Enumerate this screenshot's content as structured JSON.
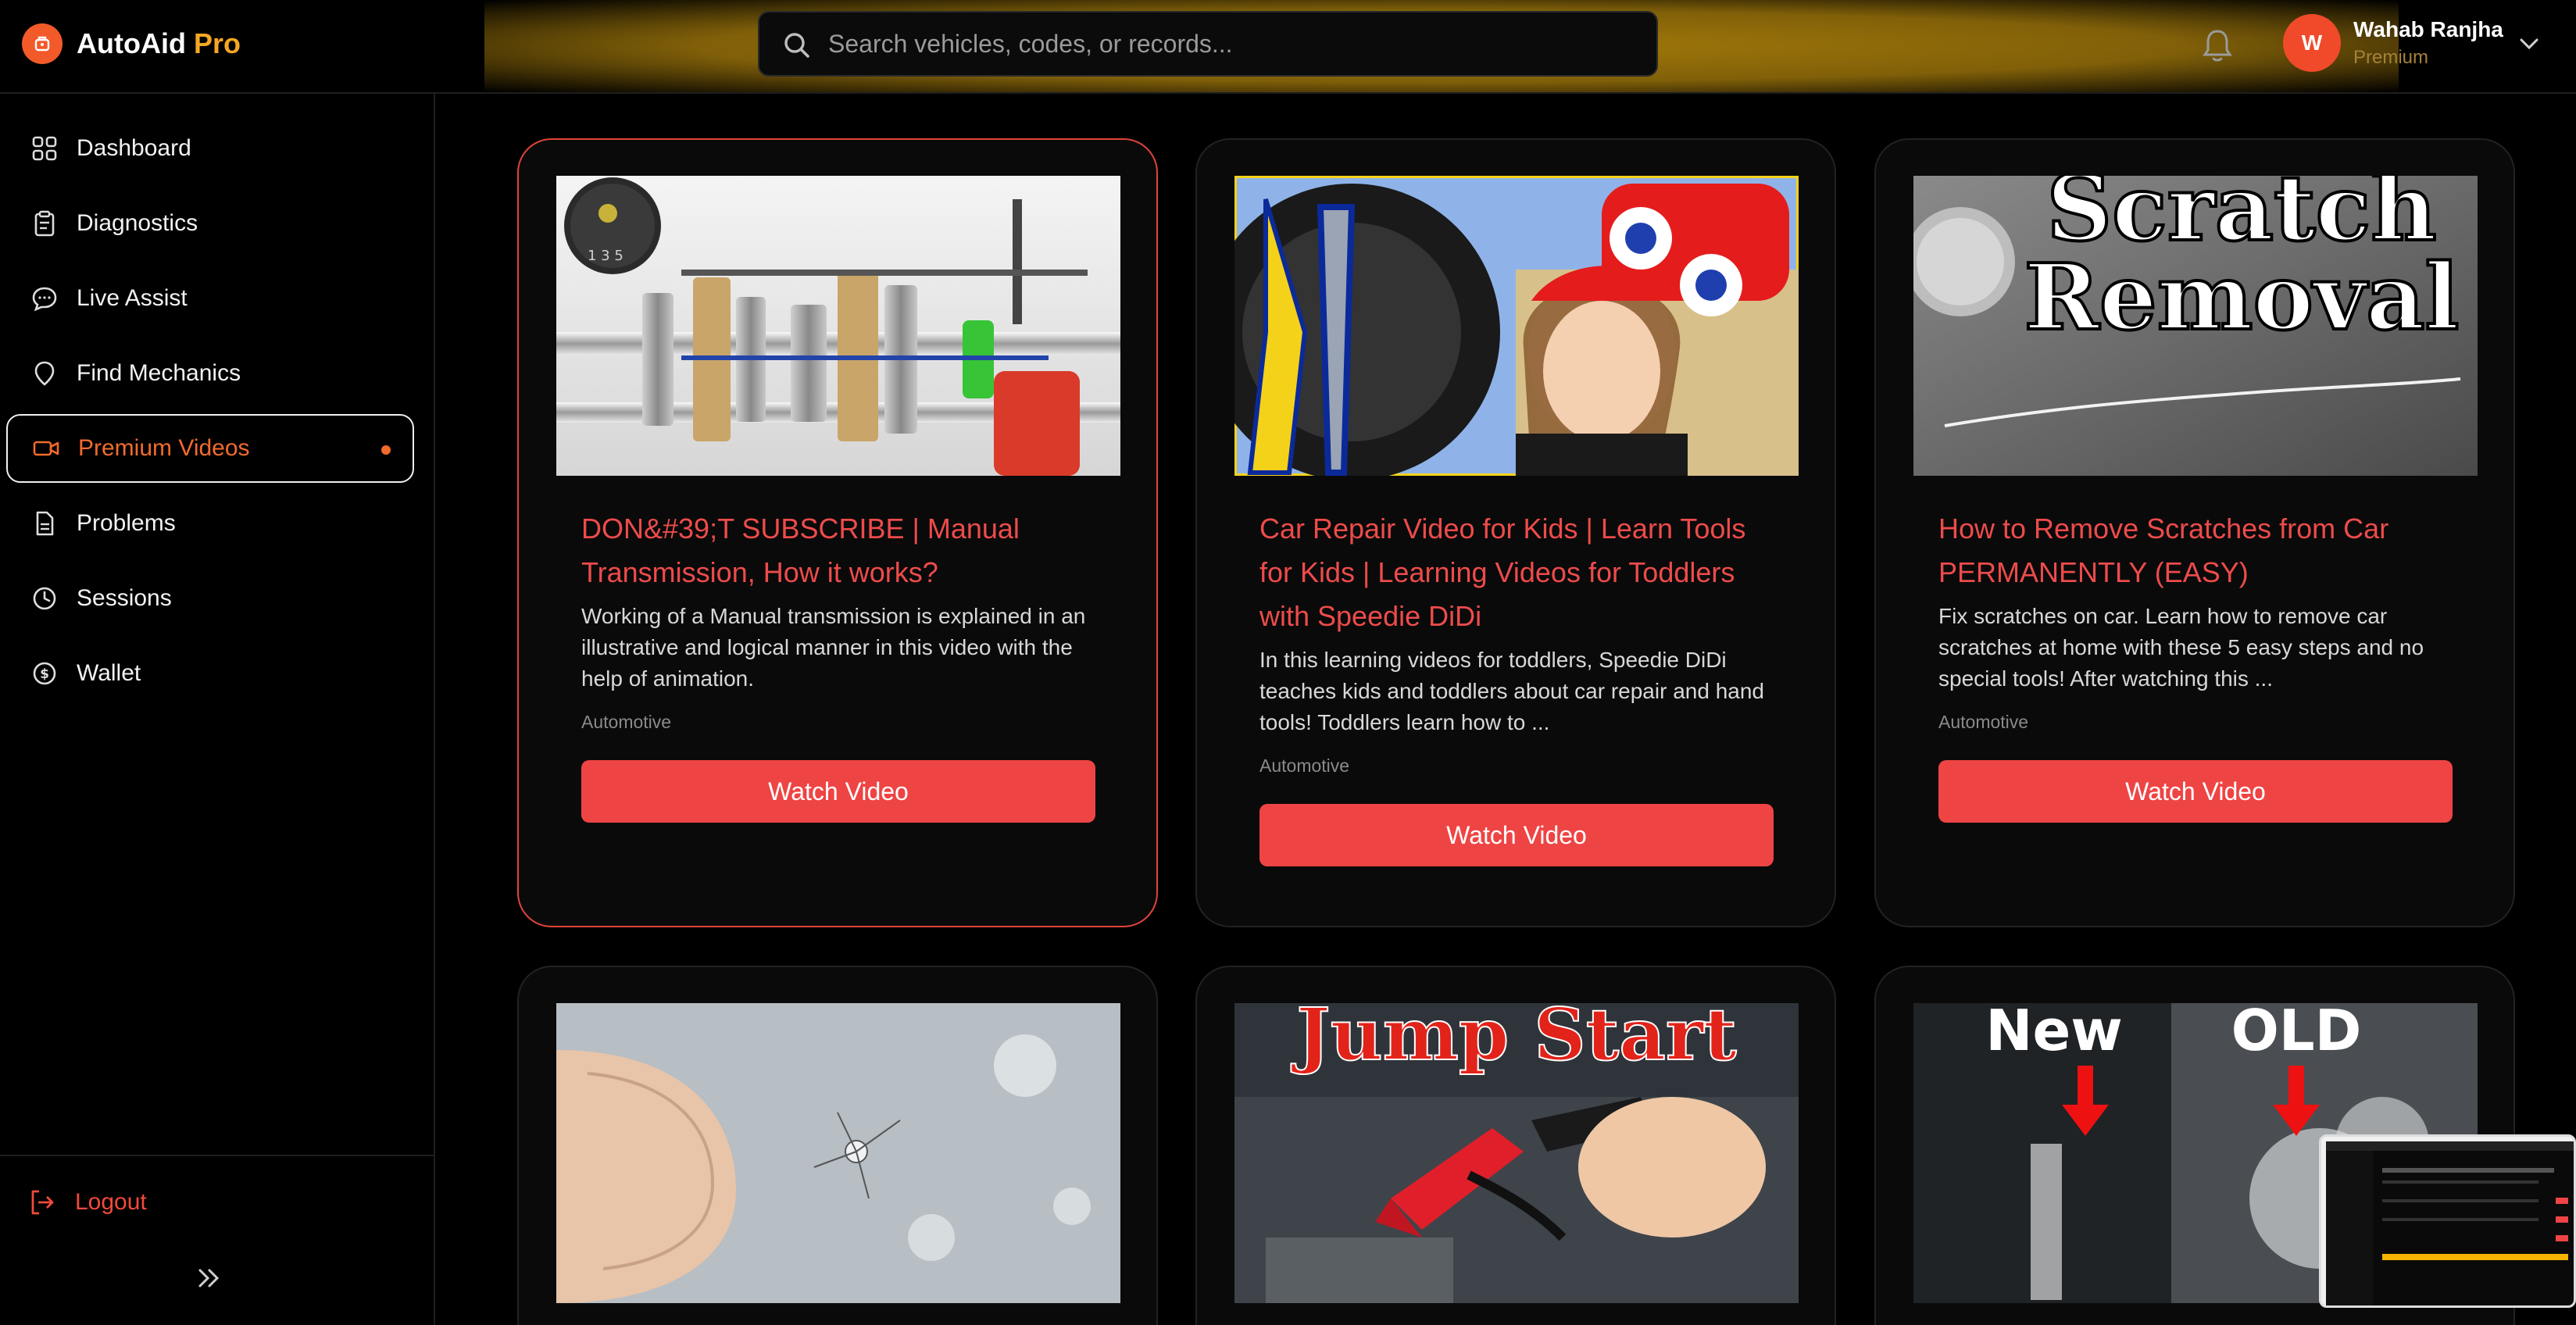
{
  "app": {
    "name": "AutoAid",
    "name_suffix": "Pro"
  },
  "search": {
    "placeholder": "Search vehicles, codes, or records..."
  },
  "user": {
    "initial": "W",
    "name": "Wahab Ranjha",
    "tier": "Premium"
  },
  "sidebar": {
    "items": [
      {
        "label": "Dashboard",
        "icon": "grid-icon"
      },
      {
        "label": "Diagnostics",
        "icon": "clipboard-icon"
      },
      {
        "label": "Live Assist",
        "icon": "chat-bubble-icon"
      },
      {
        "label": "Find Mechanics",
        "icon": "location-pin-icon"
      },
      {
        "label": "Premium Videos",
        "icon": "video-camera-icon",
        "active": true
      },
      {
        "label": "Problems",
        "icon": "document-icon"
      },
      {
        "label": "Sessions",
        "icon": "clock-icon"
      },
      {
        "label": "Wallet",
        "icon": "dollar-circle-icon"
      }
    ],
    "logout_label": "Logout"
  },
  "videos": [
    {
      "title": "DON&#39;T SUBSCRIBE | Manual Transmission, How it works?",
      "description": "Working of a Manual transmission is explained in an illustrative and logical manner in this video with the help of animation.",
      "category": "Automotive",
      "button": "Watch Video"
    },
    {
      "title": "Car Repair Video for Kids | Learn Tools for Kids | Learning Videos for Toddlers with Speedie DiDi",
      "description": "In this learning videos for toddlers, Speedie DiDi teaches kids and toddlers about car repair and hand tools! Toddlers learn how to ...",
      "category": "Automotive",
      "button": "Watch Video"
    },
    {
      "title": "How to Remove Scratches from Car PERMANENTLY (EASY)",
      "description": "Fix scratches on car. Learn how to remove car scratches at home with these 5 easy steps and no special tools! After watching this ...",
      "category": "Automotive",
      "button": "Watch Video"
    }
  ],
  "thumb_text": {
    "scratch_line1": "Scratch",
    "scratch_line2": "Removal",
    "jump": "Jump Start",
    "new": "New",
    "old": "OLD"
  },
  "colors": {
    "accent": "#f26b2c",
    "danger": "#ef4444",
    "pro": "#f5a623"
  }
}
